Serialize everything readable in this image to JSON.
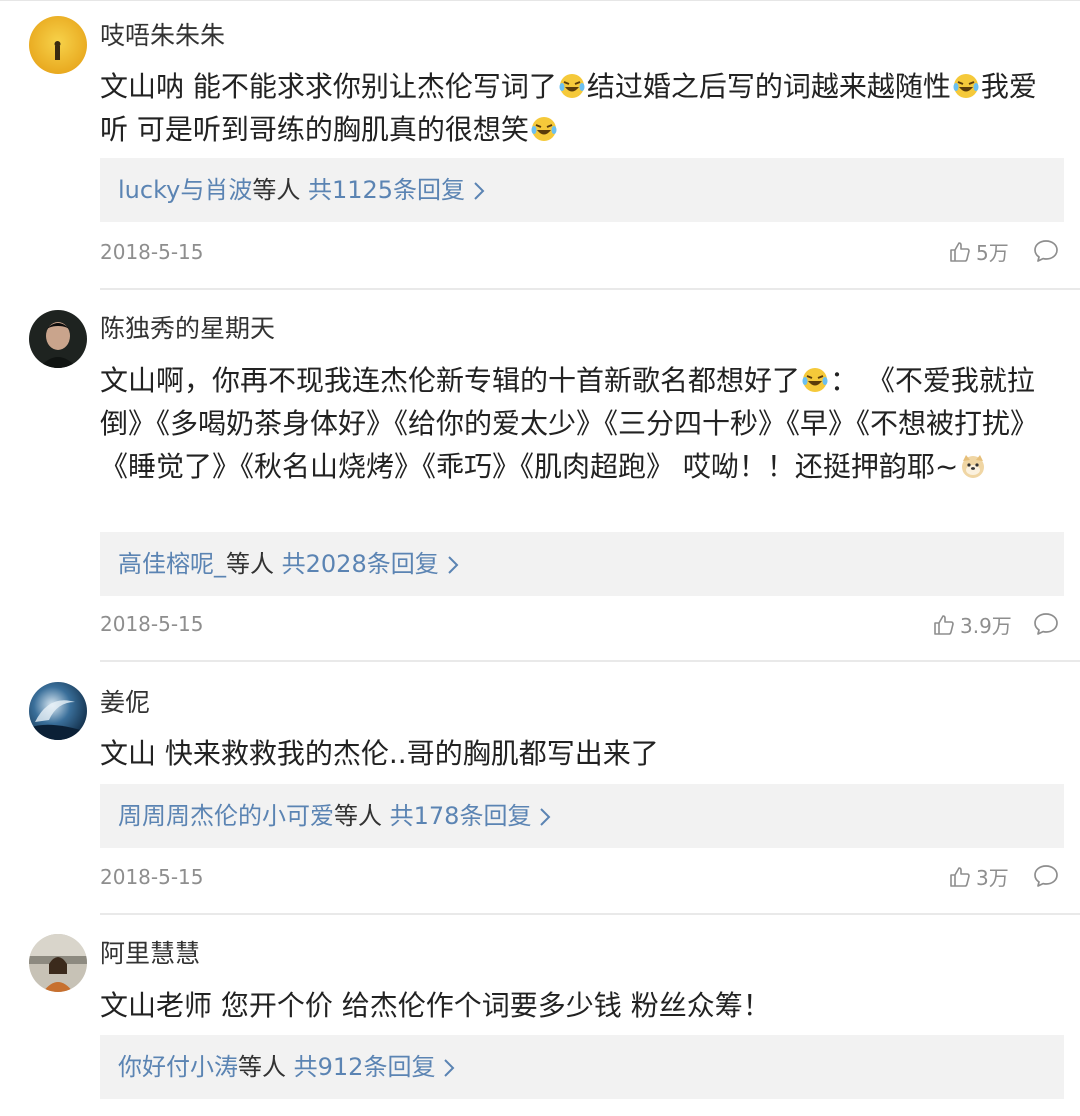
{
  "comments": [
    {
      "username": "吱唔朱朱朱",
      "text_parts": [
        "文山呐 能不能求求你别让杰伦写词了",
        "结过婚之后写的词越来越随性",
        "我爱听 可是听到哥练的胸肌真的很想笑",
        ""
      ],
      "emoji": "laugh-cry-emoji",
      "reply_users": "lucky与肖波",
      "reply_mid": "等人",
      "reply_count": "共1125条回复",
      "date": "2018-5-15",
      "likes": "5万"
    },
    {
      "username": "陈独秀的星期天",
      "text_parts": [
        "文山啊，你再不现我连杰伦新专辑的十首新歌名都想好了",
        "：  《不爱我就拉倒》《多喝奶茶身体好》《给你的爱太少》《三分四十秒》《早》《不想被打扰》《睡觉了》《秋名山烧烤》《乖巧》《肌肉超跑》 哎呦！！还挺押韵耶~",
        ""
      ],
      "emoji": "doge-emoji",
      "reply_users": "高佳榕呢_",
      "reply_mid": "等人",
      "reply_count": "共2028条回复",
      "date": "2018-5-15",
      "likes": "3.9万"
    },
    {
      "username": "姜伲",
      "text": "文山 快来救救我的杰伦..哥的胸肌都写出来了",
      "reply_users": "周周周杰伦的小可爱",
      "reply_mid": "等人",
      "reply_count": "共178条回复",
      "date": "2018-5-15",
      "likes": "3万"
    },
    {
      "username": "阿里慧慧",
      "text": "文山老师 您开个价 给杰伦作个词要多少钱 粉丝众筹！",
      "reply_users": "你好付小涛",
      "reply_mid": "等人",
      "reply_count": "共912条回复"
    }
  ],
  "colors": {
    "link": "#5b84b3",
    "meta": "#8e8e8e",
    "reply_bg": "#f2f2f2"
  },
  "icons": [
    "thumbs-up-icon",
    "comment-bubble-icon",
    "chevron-right-icon"
  ]
}
